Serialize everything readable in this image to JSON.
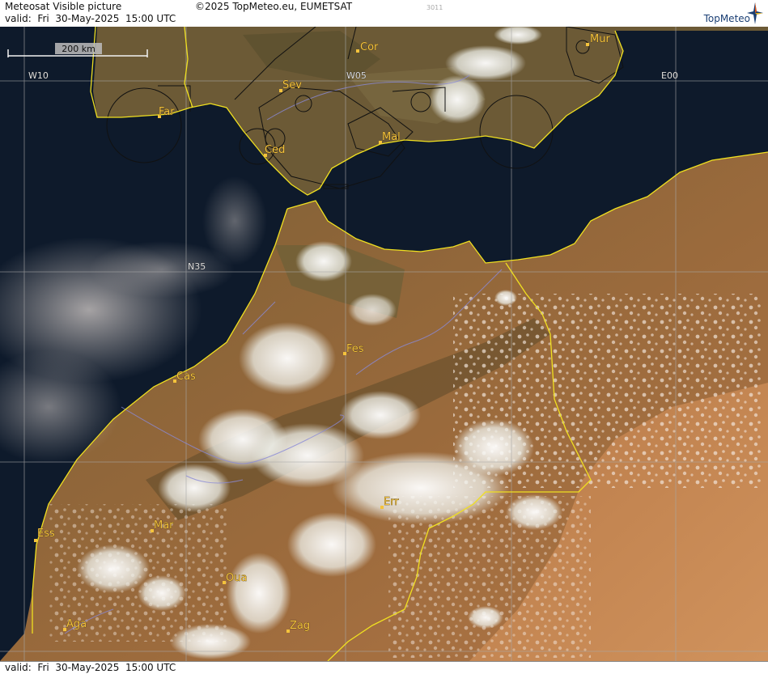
{
  "header": {
    "title": "Meteosat Visible picture",
    "valid": "valid:  Fri  30-May-2025  15:00 UTC",
    "copyright": "©2025 TopMeteo.eu, EUMETSAT",
    "frame_id": "3011",
    "logo_text": "TopMeteo"
  },
  "footer": {
    "valid": "valid:  Fri  30-May-2025  15:00 UTC"
  },
  "scale_bar": {
    "label": "200 km"
  },
  "grid_labels": {
    "w10": "W10",
    "w05": "W05",
    "e00": "E00",
    "n35": "N35"
  },
  "cities": {
    "cor": "Cor",
    "mur": "Mur",
    "sev": "Sev",
    "far": "Far",
    "ced": "Ced",
    "mal": "Mal",
    "fes": "Fes",
    "cas": "Cas",
    "err": "Err",
    "mar": "Mar",
    "ess": "Ess",
    "oua": "Oua",
    "aga": "Aga",
    "zag": "Zag"
  },
  "colors": {
    "sea": "#0e1a2b",
    "land_north": "#6e5a35",
    "land_south": "#a9703f",
    "sahara": "#c98a55",
    "cloud": "#f2f4ef",
    "coastline": "#f0e020",
    "border": "#f0e020",
    "city_label": "#f4c33c",
    "grid": "#a8a8a8",
    "river": "#8a8ad8"
  }
}
